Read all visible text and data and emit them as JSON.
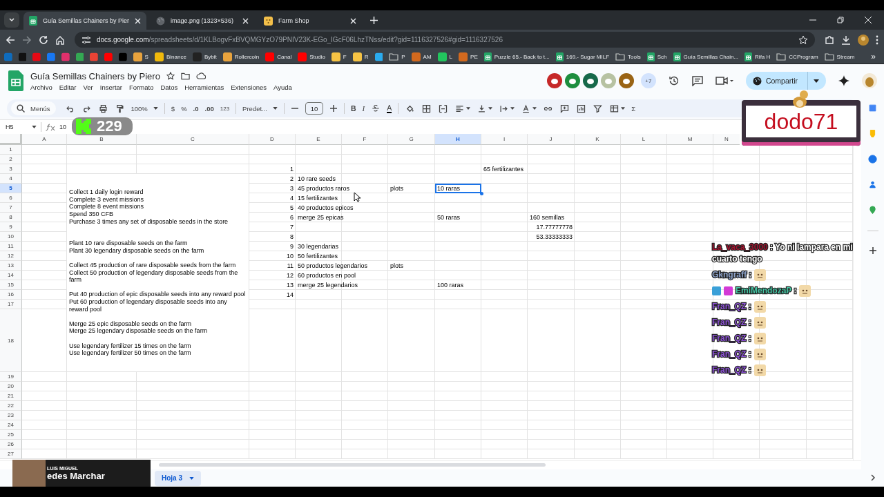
{
  "browser": {
    "tabs": [
      {
        "title": "Guía Semillas Chainers by Pier",
        "kind": "sheet",
        "selected": true
      },
      {
        "title": "image.png (1323×536)",
        "kind": "globe",
        "selected": false
      },
      {
        "title": "Farm Shop",
        "kind": "app",
        "selected": false
      }
    ],
    "url_domain": "docs.google.com",
    "url_path": "/spreadsheets/d/1KLBogvFxBVQMGYzO79PNIV23K-EGo_IGcF06LhzTNss/edit?gid=1116327526#gid=1116327526",
    "bookmarks": [
      {
        "kind": "site",
        "color": "#0f6cbd"
      },
      {
        "kind": "site",
        "color": "#111111"
      },
      {
        "kind": "site",
        "color": "#e50914"
      },
      {
        "kind": "site",
        "color": "#1877f2"
      },
      {
        "kind": "site",
        "color": "#e1306c"
      },
      {
        "kind": "site",
        "color": "#34a853"
      },
      {
        "kind": "site",
        "color": "#ea4335"
      },
      {
        "kind": "site",
        "color": "#ff0000"
      },
      {
        "kind": "site",
        "color": "#000000"
      },
      {
        "label": "S",
        "kind": "site",
        "color": "#e8a33d"
      },
      {
        "label": "Binance",
        "kind": "site",
        "color": "#f0b90b"
      },
      {
        "label": "Bybit",
        "kind": "site",
        "color": "#222222"
      },
      {
        "label": "Rollercoin",
        "kind": "site",
        "color": "#e8a33d"
      },
      {
        "label": "Canal",
        "kind": "site",
        "color": "#ff0000"
      },
      {
        "label": "Studio",
        "kind": "site",
        "color": "#ff0000"
      },
      {
        "label": "F",
        "kind": "site",
        "color": "#f6c344"
      },
      {
        "label": "R",
        "kind": "site",
        "color": "#f6c344"
      },
      {
        "kind": "site",
        "color": "#2aabee"
      },
      {
        "label": "P",
        "kind": "folder"
      },
      {
        "label": "AM",
        "kind": "site",
        "color": "#d2691e"
      },
      {
        "label": "L",
        "kind": "site",
        "color": "#22c55e"
      },
      {
        "label": "PE",
        "kind": "site",
        "color": "#d2691e"
      },
      {
        "label": "Puzzle 65.- Back to t...",
        "kind": "sheet"
      },
      {
        "label": "169.- Sugar MILF",
        "kind": "sheet"
      },
      {
        "label": "Tools",
        "kind": "folder"
      },
      {
        "label": "Sch",
        "kind": "sheet"
      },
      {
        "label": "Guía Semillas Chain...",
        "kind": "sheet"
      },
      {
        "label": "Rifa H",
        "kind": "sheet"
      },
      {
        "label": "CCProgram",
        "kind": "folder"
      },
      {
        "label": "Stream",
        "kind": "folder"
      }
    ],
    "more_bookmarks": "»"
  },
  "document": {
    "title": "Guía Semillas Chainers by Piero",
    "menu": [
      "Archivo",
      "Editar",
      "Ver",
      "Insertar",
      "Formato",
      "Datos",
      "Herramientas",
      "Extensiones",
      "Ayuda"
    ],
    "collaborators": [
      {
        "color": "#c62828"
      },
      {
        "color": "#1e8e3e"
      },
      {
        "color": "#17694a"
      },
      {
        "color": "#b7c2a2"
      },
      {
        "color": "#9a6414"
      }
    ],
    "more_collaborators": "+7",
    "share": "Compartir"
  },
  "toolbar": {
    "search": "Menús",
    "zoom": "100%",
    "currency": "$",
    "percent": "%",
    "decimal_less": ".0",
    "decimal_more": ".00",
    "number_format": "123",
    "font": "Predet...",
    "font_size": "10",
    "bold": "B",
    "italic": "I",
    "text_color": "A",
    "functions": "Σ"
  },
  "formula_bar": {
    "cell": "H5",
    "value": "10"
  },
  "sheet": {
    "columns": [
      {
        "label": "A",
        "selected": false
      },
      {
        "label": "B",
        "selected": false
      },
      {
        "label": "C",
        "selected": false
      },
      {
        "label": "D",
        "selected": false
      },
      {
        "label": "E",
        "selected": false
      },
      {
        "label": "F",
        "selected": false
      },
      {
        "label": "G",
        "selected": false
      },
      {
        "label": "H",
        "selected": true
      },
      {
        "label": "I",
        "selected": false
      },
      {
        "label": "J",
        "selected": false
      },
      {
        "label": "K",
        "selected": false
      },
      {
        "label": "L",
        "selected": false
      },
      {
        "label": "M",
        "selected": false
      },
      {
        "label": "N",
        "selected": false
      }
    ],
    "rows": [
      {
        "label": "1",
        "selected": false
      },
      {
        "label": "2",
        "selected": false
      },
      {
        "label": "3",
        "selected": false,
        "cells": [
          {
            "kind": "number",
            "text": "1",
            "selected": false
          },
          {
            "selected": false
          },
          {
            "selected": false
          },
          {
            "selected": false
          },
          {
            "selected": false
          },
          {
            "kind": "text",
            "text": "65 fertilizantes",
            "selected": false
          }
        ]
      },
      {
        "label": "4",
        "selected": false,
        "cells": [
          {
            "kind": "number",
            "text": "2",
            "selected": false
          },
          {
            "kind": "text",
            "text": "10 rare seeds",
            "selected": false
          }
        ]
      },
      {
        "label": "5",
        "selected": true,
        "cells": [
          {
            "kind": "number",
            "text": "3",
            "selected": false
          },
          {
            "kind": "text",
            "text": "45 productos raros",
            "selected": false
          },
          {
            "selected": false
          },
          {
            "kind": "text",
            "text": "plots",
            "selected": false
          },
          {
            "kind": "text",
            "text": "10 raras",
            "selected": true
          }
        ]
      },
      {
        "label": "6",
        "selected": false,
        "cells": [
          {
            "kind": "number",
            "text": "4",
            "selected": false
          },
          {
            "kind": "text",
            "text": "15 fertilizantes",
            "selected": false
          }
        ]
      },
      {
        "label": "7",
        "selected": false,
        "cells": [
          {
            "kind": "number",
            "text": "5",
            "selected": false
          },
          {
            "kind": "text",
            "text": "40 productos epicos",
            "selected": false
          }
        ]
      },
      {
        "label": "8",
        "selected": false,
        "cells": [
          {
            "kind": "number",
            "text": "6",
            "selected": false
          },
          {
            "kind": "text",
            "text": "merge 25 epicas",
            "selected": false
          },
          {
            "selected": false
          },
          {
            "selected": false
          },
          {
            "kind": "text",
            "text": "50 raras",
            "selected": false
          },
          {
            "selected": false
          },
          {
            "kind": "text",
            "text": "160 semillas",
            "selected": false
          }
        ]
      },
      {
        "label": "9",
        "selected": false,
        "cells": [
          {
            "kind": "number",
            "text": "7",
            "selected": false
          },
          {
            "selected": false
          },
          {
            "selected": false
          },
          {
            "selected": false
          },
          {
            "selected": false
          },
          {
            "selected": false
          },
          {
            "kind": "number",
            "text": "17.77777778",
            "selected": false
          }
        ]
      },
      {
        "label": "10",
        "selected": false,
        "cells": [
          {
            "kind": "number",
            "text": "8",
            "selected": false
          },
          {
            "selected": false
          },
          {
            "selected": false
          },
          {
            "selected": false
          },
          {
            "selected": false
          },
          {
            "selected": false
          },
          {
            "kind": "number",
            "text": "53.33333333",
            "selected": false
          }
        ]
      },
      {
        "label": "11",
        "selected": false,
        "cells": [
          {
            "kind": "number",
            "text": "9",
            "selected": false
          },
          {
            "kind": "text",
            "text": "30 legendarias",
            "selected": false
          }
        ]
      },
      {
        "label": "12",
        "selected": false,
        "cells": [
          {
            "kind": "number",
            "text": "10",
            "selected": false
          },
          {
            "kind": "text",
            "text": "50 fertilizantes",
            "selected": false
          }
        ]
      },
      {
        "label": "13",
        "selected": false,
        "cells": [
          {
            "kind": "number",
            "text": "11",
            "selected": false
          },
          {
            "kind": "text",
            "text": "50 productos legendarios",
            "selected": false
          },
          {
            "selected": false
          },
          {
            "kind": "text",
            "text": "plots",
            "selected": false
          }
        ]
      },
      {
        "label": "14",
        "selected": false,
        "cells": [
          {
            "kind": "number",
            "text": "12",
            "selected": false
          },
          {
            "kind": "text",
            "text": "60 productos en pool",
            "selected": false
          }
        ]
      },
      {
        "label": "15",
        "selected": false,
        "cells": [
          {
            "kind": "number",
            "text": "13",
            "selected": false
          },
          {
            "kind": "text",
            "text": "merge 25 legendarios",
            "selected": false
          },
          {
            "selected": false
          },
          {
            "selected": false
          },
          {
            "kind": "text",
            "text": "100 raras",
            "selected": false
          }
        ]
      },
      {
        "label": "16",
        "selected": false,
        "cells": [
          {
            "kind": "number",
            "text": "14",
            "selected": false
          }
        ]
      },
      {
        "label": "17",
        "selected": false
      },
      {
        "label": "18",
        "selected": false
      },
      {
        "label": "19",
        "selected": false
      },
      {
        "label": "20",
        "selected": false
      },
      {
        "label": "21",
        "selected": false
      },
      {
        "label": "22",
        "selected": false
      },
      {
        "label": "23",
        "selected": false
      },
      {
        "label": "24",
        "selected": false
      },
      {
        "label": "25",
        "selected": false
      },
      {
        "label": "26",
        "selected": false
      },
      {
        "label": "27",
        "selected": false
      }
    ],
    "merged_cell": {
      "text": "Collect 1 daily login reward\nComplete 3 event missions\nComplete 8 event missions\nSpend 350 CFB\nPurchase 3 times any set of disposable seeds in the store\n\n\nPlant 10 rare disposable seeds on the farm\nPlant 30 legendary disposable seeds on the farm\n\nCollect 45 production of rare disposable seeds from the farm\nCollect 50 production of legendary disposable seeds from the farm\n\nPut 40 production of epic disposable seeds into any reward pool\nPut 60 production of legendary disposable seeds into any reward pool\n\nMerge 25 epic disposable seeds on the farm\nMerge 25 legendary disposable seeds on the farm\n\nUse legendary fertilizer 15 times on the farm\nUse legendary fertilizer 50 times on the farm"
    }
  },
  "sheet_tabs": [
    {
      "label": "Hoja 3",
      "selected": true
    }
  ],
  "overlays": {
    "counter": "229",
    "nameplate": "dodo71",
    "chat": [
      {
        "user": "La_vaca_3000",
        "color": "#a3122e",
        "text": ": Yo ni lampara en mi cuarto tengo",
        "emote": false
      },
      {
        "user": "Gkngraff",
        "color": "#8ea4cc",
        "text": ":",
        "emote": true
      },
      {
        "user": "EmiMendozaP",
        "color": "#45c6a4",
        "badges": [
          {
            "color": "#3aa0d8"
          },
          {
            "color": "#d33ad6"
          }
        ],
        "text": ":",
        "emote": true
      },
      {
        "user": "Fran_QZ",
        "color": "#8d52d6",
        "text": ":",
        "emote": true
      },
      {
        "user": "Fran_QZ",
        "color": "#8d52d6",
        "text": ":",
        "emote": true
      },
      {
        "user": "Fran_QZ",
        "color": "#8d52d6",
        "text": ":",
        "emote": true
      },
      {
        "user": "Fran_QZ",
        "color": "#8d52d6",
        "text": ":",
        "emote": true
      },
      {
        "user": "Fran_QZ",
        "color": "#8d52d6",
        "text": ":",
        "emote": true
      }
    ],
    "now_playing": {
      "artist": "LUIS MIGUEL",
      "song": "edes Marchar"
    }
  }
}
